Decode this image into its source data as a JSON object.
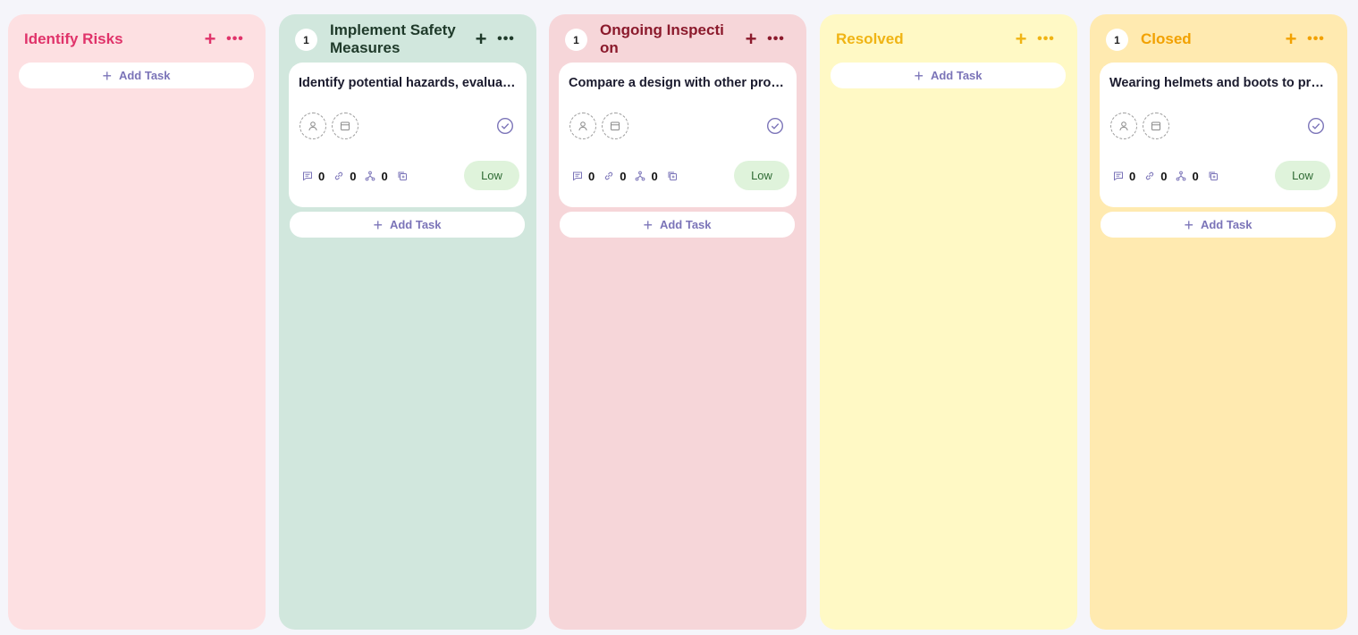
{
  "columns": [
    {
      "title": "Identify Risks",
      "count": "",
      "bg": "#fde0e2",
      "accent": "#e0336a",
      "add_task_label": "Add Task",
      "cards": []
    },
    {
      "title": "Implement Safety Measures",
      "count": "1",
      "bg": "#d1e7dd",
      "accent": "#1f3a2a",
      "add_task_label": "Add Task",
      "cards": [
        {
          "title": "Identify potential hazards, evaluate risks and implement controls",
          "comments": "0",
          "links": "0",
          "subtasks": "0",
          "priority": "Low"
        }
      ]
    },
    {
      "title": "Ongoing Inspection",
      "count": "1",
      "bg": "#f6d6d9",
      "accent": "#8b1a2c",
      "add_task_label": "Add Task",
      "cards": [
        {
          "title": "Compare a design with other products",
          "comments": "0",
          "links": "0",
          "subtasks": "0",
          "priority": "Low"
        }
      ]
    },
    {
      "title": "Resolved",
      "count": "",
      "bg": "#fff9c5",
      "accent": "#f0b414",
      "add_task_label": "Add Task",
      "cards": []
    },
    {
      "title": "Closed",
      "count": "1",
      "bg": "#ffeab0",
      "accent": "#f2a100",
      "add_task_label": "Add Task",
      "cards": [
        {
          "title": "Wearing helmets and boots to prevent injuries",
          "comments": "0",
          "links": "0",
          "subtasks": "0",
          "priority": "Low"
        }
      ]
    }
  ],
  "icons": {
    "add": "plus-icon",
    "more": "more-horizontal-icon",
    "assignee": "user-icon",
    "date": "calendar-icon",
    "complete": "check-circle-icon",
    "comments": "comment-icon",
    "links": "link-icon",
    "subtasks": "subtask-icon",
    "attachments": "copy-icon"
  }
}
